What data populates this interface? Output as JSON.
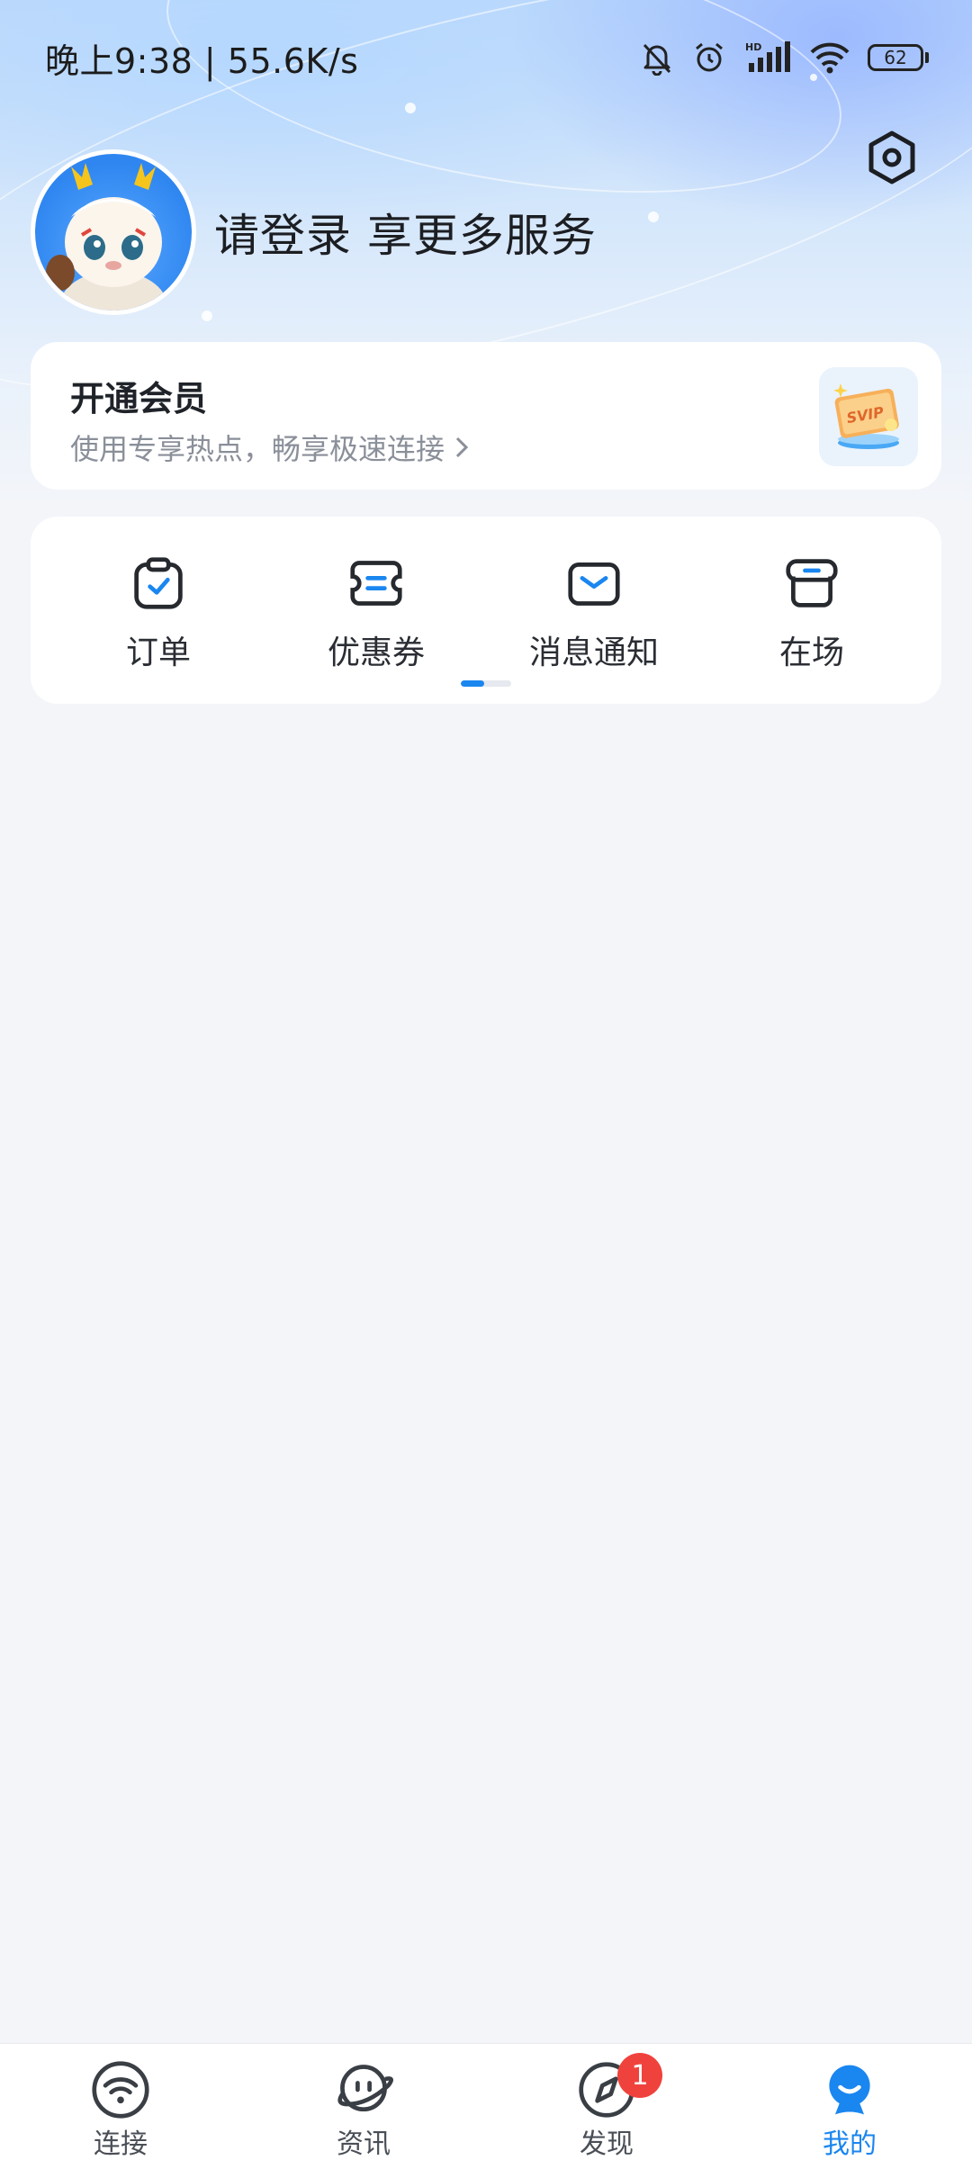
{
  "status_bar": {
    "time_speed": "晚上9:38 | 55.6K/s",
    "battery": "62",
    "icons": [
      "bell-muted-icon",
      "alarm-icon",
      "hd-signal-icon",
      "wifi-icon",
      "battery-icon"
    ]
  },
  "header": {
    "login_prompt": "请登录 享更多服务",
    "settings_icon": "settings-hexagon-icon"
  },
  "vip_card": {
    "title": "开通会员",
    "subtitle": "使用专享热点，畅享极速连接",
    "badge_text": "SVIP"
  },
  "quick_actions": [
    {
      "label": "订单",
      "icon": "clipboard-check-icon"
    },
    {
      "label": "优惠券",
      "icon": "coupon-icon"
    },
    {
      "label": "消息通知",
      "icon": "envelope-icon"
    },
    {
      "label": "在场",
      "icon": "store-icon"
    }
  ],
  "bottom_nav": [
    {
      "label": "连接",
      "icon": "wifi-nav-icon"
    },
    {
      "label": "资讯",
      "icon": "planet-nav-icon"
    },
    {
      "label": "发现",
      "icon": "compass-nav-icon",
      "badge": "1"
    },
    {
      "label": "我的",
      "icon": "profile-nav-icon"
    }
  ],
  "colors": {
    "accent": "#1a86f0",
    "badge": "#f0423c",
    "background": "#f3f5f9"
  }
}
